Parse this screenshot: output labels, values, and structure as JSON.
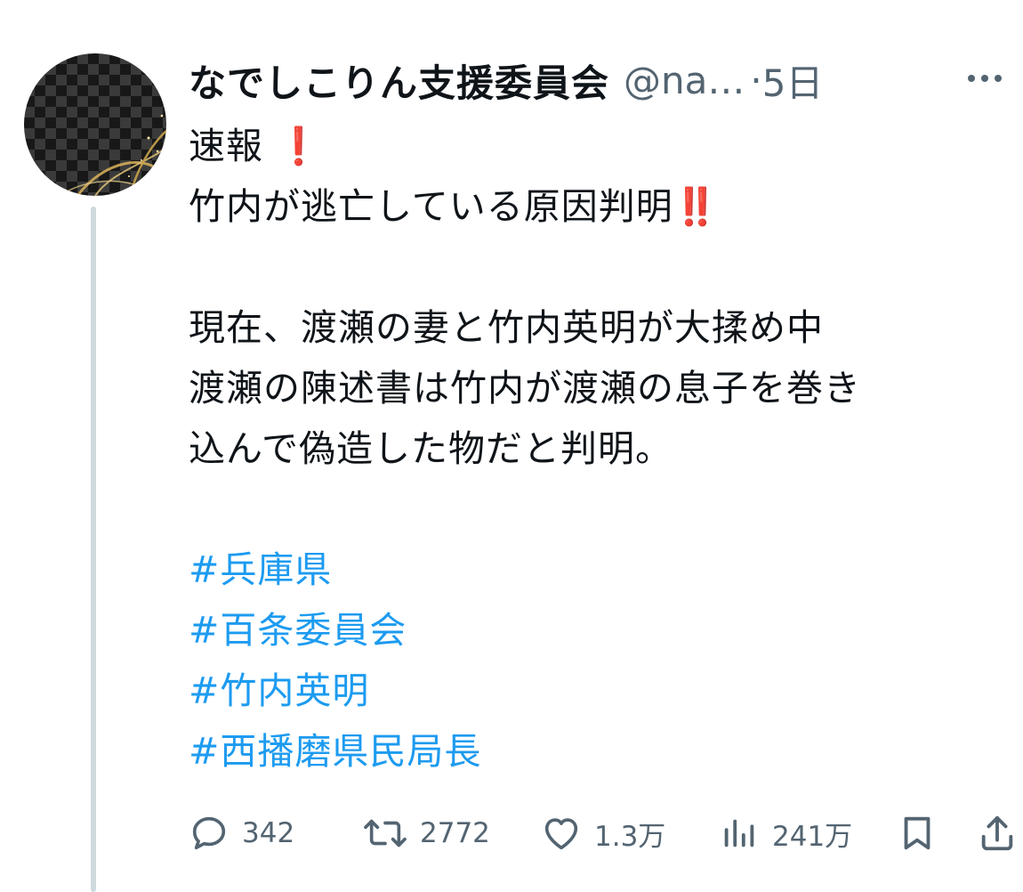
{
  "post": {
    "display_name": "なでしこりん支援委員会",
    "handle": "@na…",
    "separator": "·",
    "time": "5日",
    "lines": [
      "速報",
      "竹内が逃亡している原因判明",
      "",
      "現在、渡瀬の妻と竹内英明が大揉め中",
      "渡瀬の陳述書は竹内が渡瀬の息子を巻き",
      "込んで偽造した物だと判明。",
      ""
    ],
    "emoji": {
      "single_excl": "❗",
      "double_excl": "‼️"
    },
    "hashtags": [
      "#兵庫県",
      "#百条委員会",
      "#竹内英明",
      "#西播磨県民局長"
    ]
  },
  "actions": {
    "replies": "342",
    "reposts": "2772",
    "likes": "1.3万",
    "views": "241万"
  },
  "icons": {
    "avatar": "checkered-avatar",
    "more": "more-icon",
    "reply": "reply-icon",
    "repost": "repost-icon",
    "like": "heart-icon",
    "views": "views-icon",
    "bookmark": "bookmark-icon",
    "share": "share-icon"
  },
  "colors": {
    "text": "#0f1419",
    "secondary": "#536471",
    "hashtag": "#1d9bf0",
    "emoji_red": "#e0102a",
    "thread_line": "#cfd9de"
  }
}
